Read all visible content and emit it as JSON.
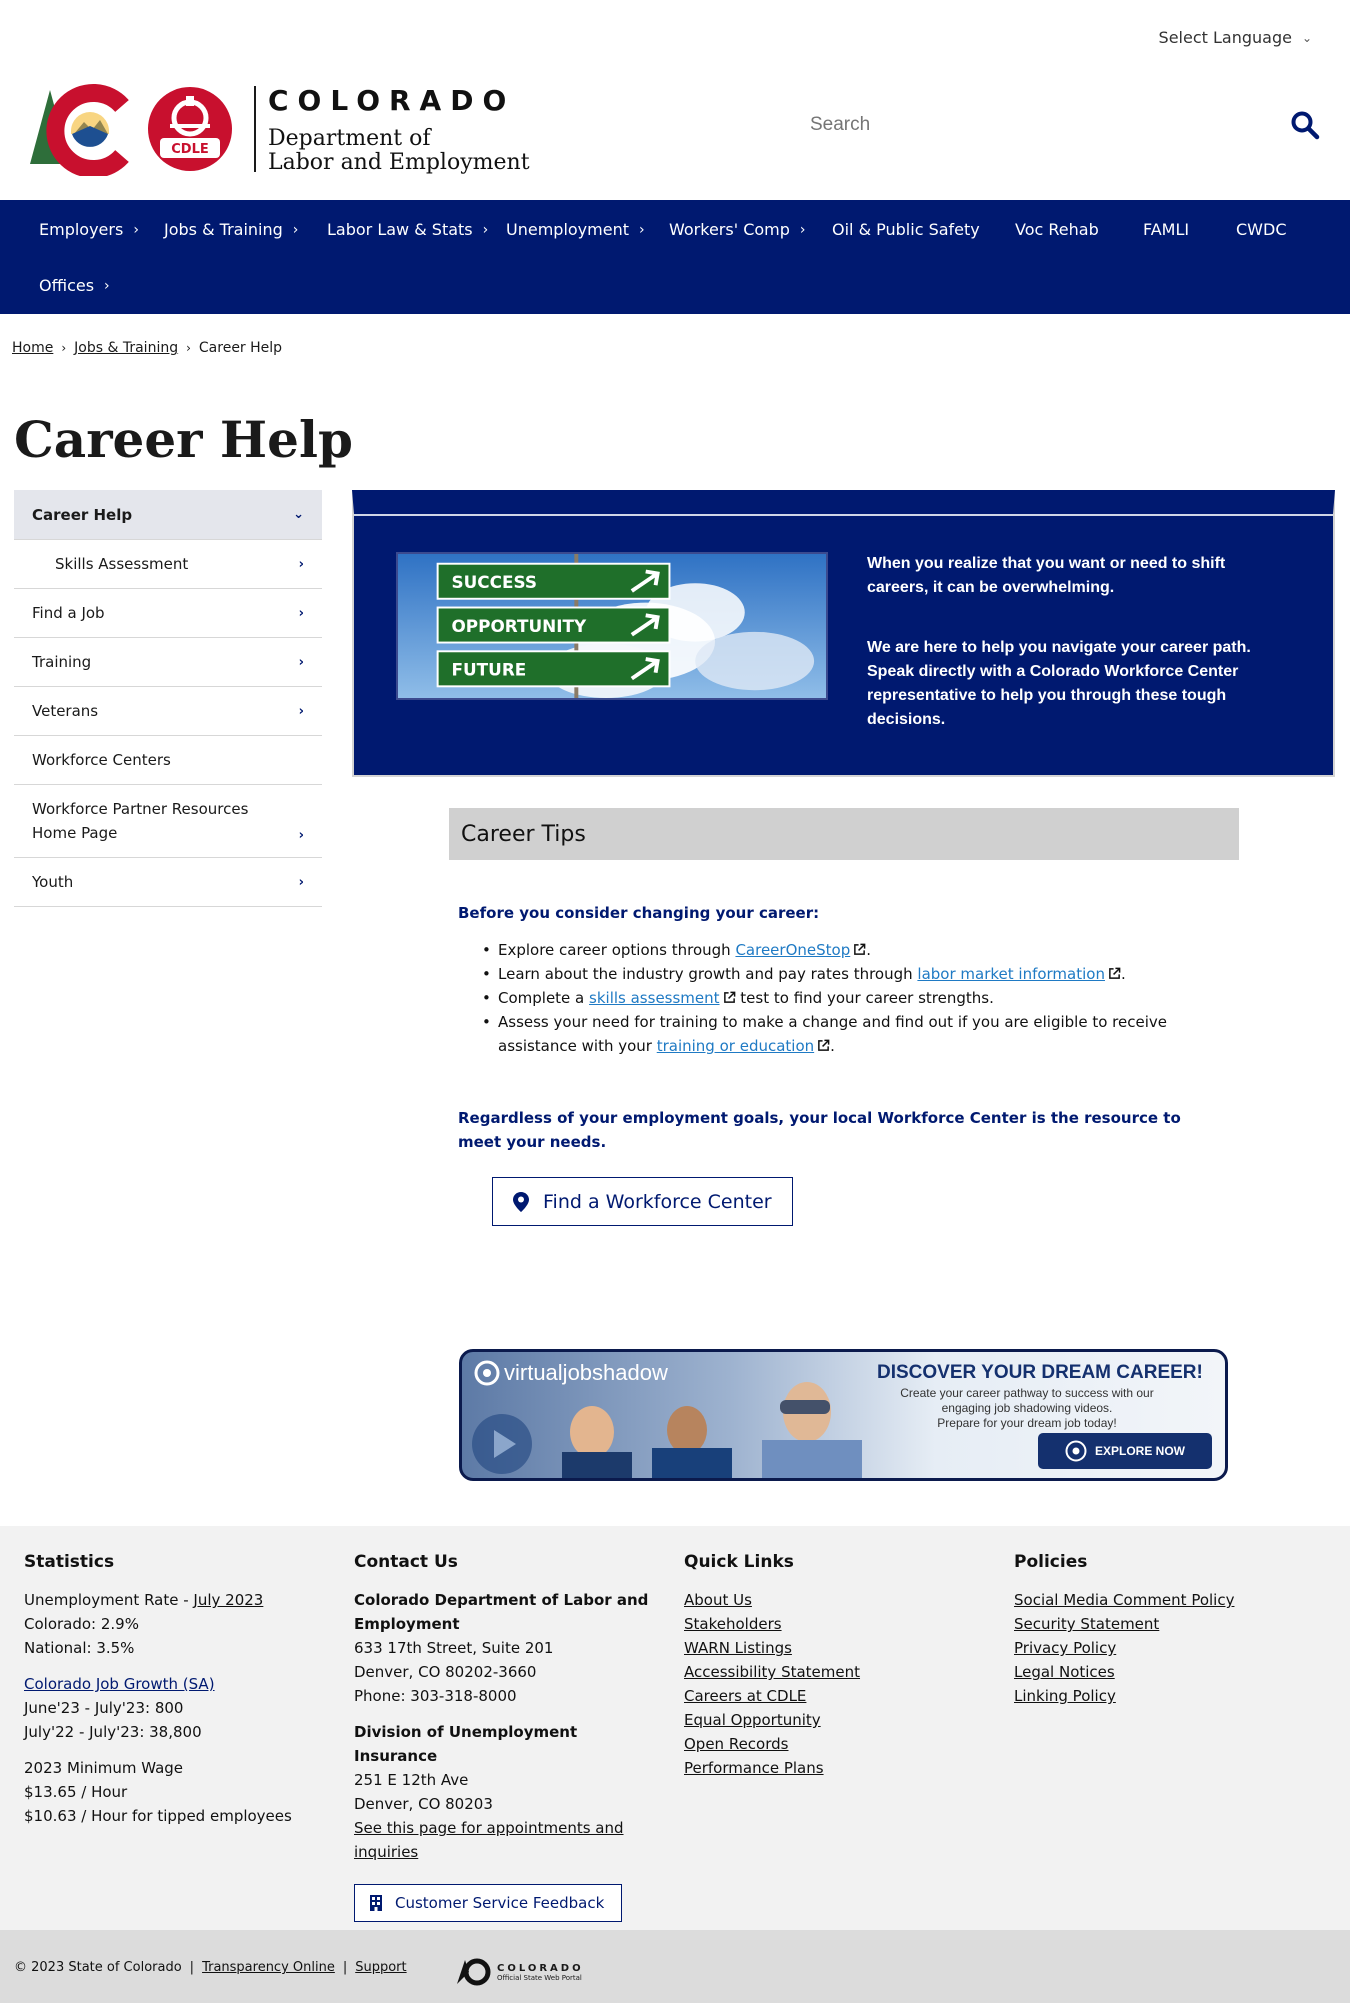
{
  "header": {
    "language_select": "Select Language",
    "brand_state": "COLORADO",
    "brand_dept_line1": "Department of",
    "brand_dept_line2": "Labor and Employment",
    "cdle_badge": "CDLE",
    "search_placeholder": "Search"
  },
  "nav": {
    "items": [
      {
        "label": "Employers"
      },
      {
        "label": "Jobs & Training"
      },
      {
        "label": "Labor Law & Stats"
      },
      {
        "label": "Unemployment"
      },
      {
        "label": "Workers' Comp"
      },
      {
        "label": "Oil & Public Safety"
      },
      {
        "label": "Voc Rehab"
      },
      {
        "label": "FAMLI"
      },
      {
        "label": "CWDC"
      },
      {
        "label": "Offices"
      }
    ]
  },
  "breadcrumb": {
    "home": "Home",
    "jobs": "Jobs & Training",
    "current": "Career Help"
  },
  "page": {
    "title": "Career Help"
  },
  "sidebar": {
    "items": [
      {
        "label": "Career Help"
      },
      {
        "label": "Skills Assessment"
      },
      {
        "label": "Find a Job"
      },
      {
        "label": "Training"
      },
      {
        "label": "Veterans"
      },
      {
        "label": "Workforce Centers"
      },
      {
        "label": "Workforce Partner Resources Home Page"
      },
      {
        "label": "Youth"
      }
    ]
  },
  "hero": {
    "signs": [
      "SUCCESS",
      "OPPORTUNITY",
      "FUTURE"
    ],
    "text1": "When you realize that you want or need to shift careers, it can be overwhelming.",
    "text2": "We are here to help you navigate your career path. Speak directly with a Colorado Workforce Center representative to help you through these tough decisions."
  },
  "tips": {
    "heading": "Career Tips",
    "lead": "Before you consider changing your career:",
    "b1_pre": "Explore career options through ",
    "b1_link": "CareerOneStop",
    "b1_post": ".",
    "b2_pre": "Learn about the industry growth and pay rates through ",
    "b2_link": "labor market information",
    "b2_post": ".",
    "b3_pre": "Complete a ",
    "b3_link": "skills assessment",
    "b3_post": " test to find your career strengths.",
    "b4_pre": "Assess your need for training to make a change and find out if you are eligible to receive assistance with your ",
    "b4_link": "training or education",
    "b4_post": ".",
    "regardless": "Regardless of your employment goals, your local Workforce Center is the resource to meet your needs.",
    "find_button": "Find a Workforce Center"
  },
  "banner": {
    "logo": "virtualjobshadow",
    "title": "DISCOVER YOUR DREAM CAREER!",
    "sub1": "Create your career pathway to success with our engaging job shadowing videos.",
    "sub2": "Prepare for your dream job today!",
    "button": "EXPLORE NOW"
  },
  "footer": {
    "statistics": {
      "heading": "Statistics",
      "unemp_label": "Unemployment Rate - ",
      "unemp_link": "July 2023",
      "colorado": "Colorado: 2.9%",
      "national": "National: 3.5%",
      "growth_link": "Colorado Job Growth (SA)",
      "growth1": "June'23 - July'23: 800",
      "growth2": "July'22 - July'23: 38,800",
      "minwage_label": "2023 Minimum Wage",
      "minwage1": "$13.65 / Hour",
      "minwage2": "$10.63 / Hour for tipped employees"
    },
    "contact": {
      "heading": "Contact Us",
      "org1": "Colorado Department of Labor and Employment",
      "addr1": "633 17th Street, Suite 201",
      "city1": "Denver, CO  80202-3660",
      "phone": "Phone: 303-318-8000",
      "org2": "Division of Unemployment Insurance",
      "addr2": "251 E 12th Ave",
      "city2": "Denver, CO  80203",
      "appt_link": "See this page for appointments and inquiries",
      "feedback": "Customer Service Feedback"
    },
    "quicklinks": {
      "heading": "Quick Links",
      "items": [
        "About Us",
        "Stakeholders",
        "WARN Listings",
        "Accessibility Statement",
        "Careers at CDLE",
        "Equal Opportunity",
        "Open Records",
        "Performance Plans"
      ]
    },
    "policies": {
      "heading": "Policies",
      "items": [
        "Social Media Comment Policy",
        "Security Statement",
        "Privacy Policy",
        "Legal Notices",
        "Linking Policy"
      ]
    },
    "bottom": {
      "copyright": "© 2023 State of Colorado",
      "sep": "|",
      "transparency": "Transparency Online",
      "support": "Support",
      "portal_line1": "COLORADO",
      "portal_line2": "Official State Web Portal"
    }
  }
}
